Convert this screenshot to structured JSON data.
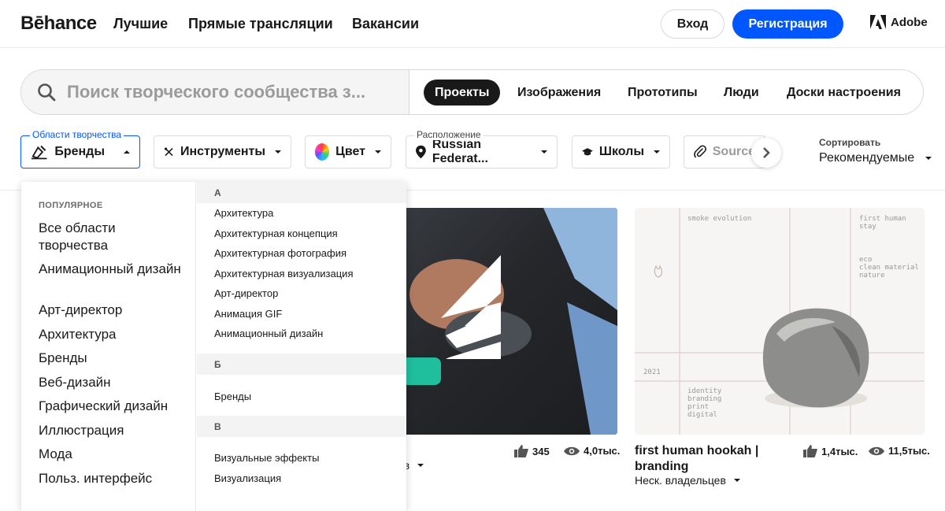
{
  "header": {
    "logo": "Bēhance",
    "nav": [
      "Лучшие",
      "Прямые трансляции",
      "Вакансии"
    ],
    "login": "Вход",
    "signup": "Регистрация",
    "adobe": "Adobe",
    "accent": "#0057ff"
  },
  "search": {
    "placeholder": "Поиск творческого сообщества з...",
    "tabs": [
      "Проекты",
      "Изображения",
      "Прототипы",
      "Люди",
      "Доски настроения"
    ],
    "active_tab": "Проекты"
  },
  "filters": {
    "creative_fields_label": "Области творчества",
    "creative_fields_value": "Бренды",
    "tools": "Инструменты",
    "color": "Цвет",
    "location_label": "Расположение",
    "location_value": "Russian Federat...",
    "schools": "Школы",
    "source": "Source",
    "sort_label": "Сортировать",
    "sort_value": "Рекомендуемые"
  },
  "dropdown": {
    "popular_heading": "ПОПУЛЯРНОЕ",
    "popular": [
      "Все области творчества",
      "Анимационный дизайн",
      "Арт-директор",
      "Архитектура",
      "Бренды",
      "Веб-дизайн",
      "Графический дизайн",
      "Иллюстрация",
      "Мода",
      "Польз. интерфейс"
    ],
    "sections": [
      {
        "letter": "А",
        "items": [
          "Архитектура",
          "Архитектурная концепция",
          "Архитектурная фотография",
          "Архитектурная визуализация",
          "Арт-директор",
          "Анимация GIF",
          "Анимационный дизайн"
        ]
      },
      {
        "letter": "Б",
        "items": [
          "Бренды"
        ]
      },
      {
        "letter": "В",
        "items": [
          "Визуальные эффекты",
          "Визуализация"
        ]
      }
    ]
  },
  "cards": [
    {
      "owner_partial": "ев",
      "likes": "345",
      "views": "4,0тыс."
    },
    {
      "title": "first human hookah | branding",
      "owner": "Неск. владельцев",
      "likes": "1,4тыс.",
      "views": "11,5тыс.",
      "image_texts": {
        "smoke": "smoke evolution",
        "stay": "first human stay",
        "eco": "eco",
        "clean": "clean material",
        "nature": "nature",
        "year": "2021",
        "identity": "identity",
        "branding": "branding",
        "print": "print",
        "digital": "digital"
      }
    }
  ]
}
